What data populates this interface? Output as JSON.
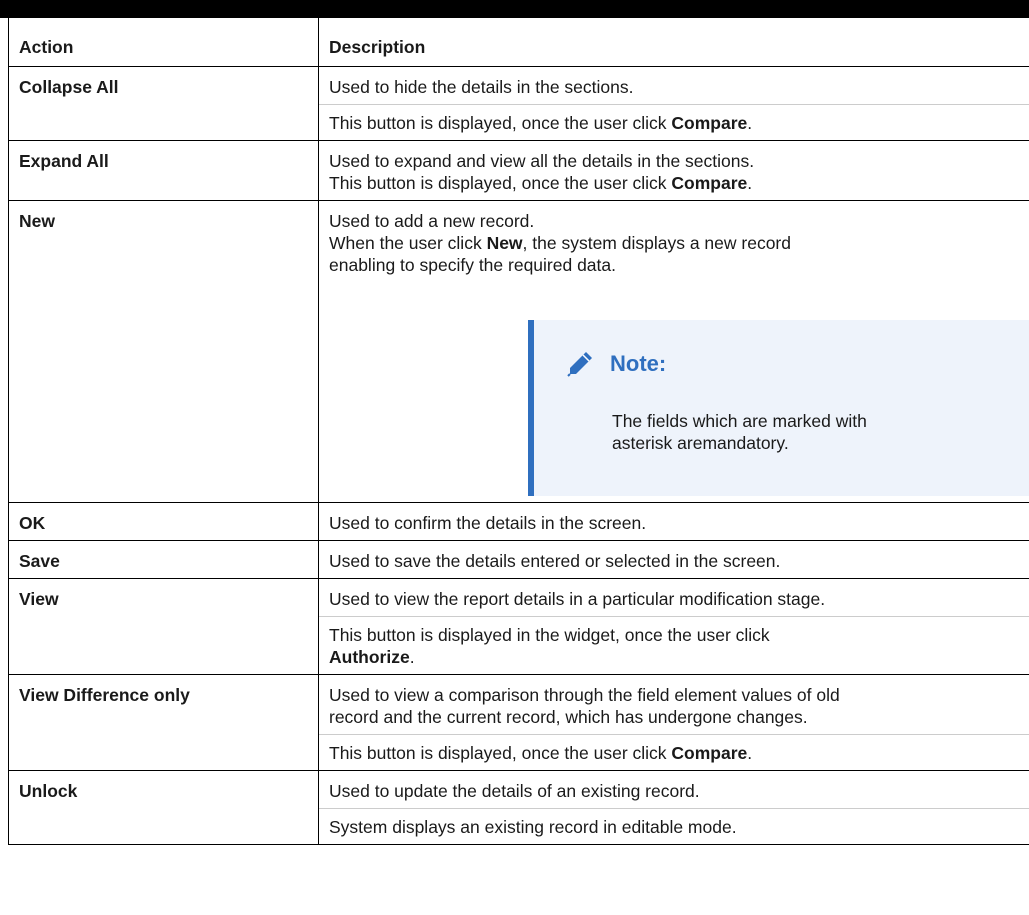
{
  "table": {
    "header": {
      "action": "Action",
      "description": "Description"
    },
    "rows": [
      {
        "action": "Collapse All",
        "paras": [
          {
            "lines": [
              {
                "segments": [
                  {
                    "text": "Used to hide the details in the sections.",
                    "bold": false
                  }
                ]
              }
            ]
          },
          {
            "lines": [
              {
                "segments": [
                  {
                    "text": "This button is displayed, once the user click ",
                    "bold": false
                  },
                  {
                    "text": "Compare",
                    "bold": true
                  },
                  {
                    "text": ".",
                    "bold": false
                  }
                ]
              }
            ]
          }
        ]
      },
      {
        "action": "Expand All",
        "paras": [
          {
            "lines": [
              {
                "segments": [
                  {
                    "text": "Used to expand and view all the details in the sections.",
                    "bold": false
                  }
                ]
              },
              {
                "segments": [
                  {
                    "text": "This button is displayed, once the user click ",
                    "bold": false
                  },
                  {
                    "text": "Compare",
                    "bold": true
                  },
                  {
                    "text": ".",
                    "bold": false
                  }
                ]
              }
            ]
          }
        ]
      },
      {
        "action": "New",
        "paras": [
          {
            "lines": [
              {
                "segments": [
                  {
                    "text": "Used to add a new record.",
                    "bold": false
                  }
                ]
              },
              {
                "segments": [
                  {
                    "text": "When the user click ",
                    "bold": false
                  },
                  {
                    "text": "New",
                    "bold": true
                  },
                  {
                    "text": ", the system displays a new record",
                    "bold": false
                  }
                ]
              },
              {
                "segments": [
                  {
                    "text": "enabling to specify the required data.",
                    "bold": false
                  }
                ]
              }
            ]
          }
        ],
        "note": {
          "title": "Note:",
          "icon": "pencil-icon",
          "lines": [
            "The fields which are marked with",
            "asterisk aremandatory."
          ]
        }
      },
      {
        "action": "OK",
        "paras": [
          {
            "lines": [
              {
                "segments": [
                  {
                    "text": "Used to confirm the details in the screen.",
                    "bold": false
                  }
                ]
              }
            ]
          }
        ]
      },
      {
        "action": "Save",
        "paras": [
          {
            "lines": [
              {
                "segments": [
                  {
                    "text": "Used to save the details entered or selected in the screen.",
                    "bold": false
                  }
                ]
              }
            ]
          }
        ]
      },
      {
        "action": "View",
        "paras": [
          {
            "lines": [
              {
                "segments": [
                  {
                    "text": "Used to view the report details in a particular modification stage.",
                    "bold": false
                  }
                ]
              }
            ]
          },
          {
            "lines": [
              {
                "segments": [
                  {
                    "text": "This button is displayed in the widget, once the user click",
                    "bold": false
                  }
                ]
              },
              {
                "segments": [
                  {
                    "text": "Authorize",
                    "bold": true
                  },
                  {
                    "text": ".",
                    "bold": false
                  }
                ]
              }
            ]
          }
        ]
      },
      {
        "action": "View Difference only",
        "paras": [
          {
            "lines": [
              {
                "segments": [
                  {
                    "text": "Used to view a comparison through the field element values of old",
                    "bold": false
                  }
                ]
              },
              {
                "segments": [
                  {
                    "text": "record and the current record, which has undergone changes.",
                    "bold": false
                  }
                ]
              }
            ]
          },
          {
            "lines": [
              {
                "segments": [
                  {
                    "text": "This button is displayed, once the user click ",
                    "bold": false
                  },
                  {
                    "text": "Compare",
                    "bold": true
                  },
                  {
                    "text": ".",
                    "bold": false
                  }
                ]
              }
            ]
          }
        ]
      },
      {
        "action": "Unlock",
        "paras": [
          {
            "lines": [
              {
                "segments": [
                  {
                    "text": "Used to update the details of an existing record.",
                    "bold": false
                  }
                ]
              }
            ]
          },
          {
            "lines": [
              {
                "segments": [
                  {
                    "text": "System displays an existing record in editable mode.",
                    "bold": false
                  }
                ]
              }
            ]
          }
        ]
      }
    ]
  },
  "colors": {
    "note_accent": "#2f6fbf",
    "note_background": "#eef3fb",
    "border": "#000000"
  }
}
